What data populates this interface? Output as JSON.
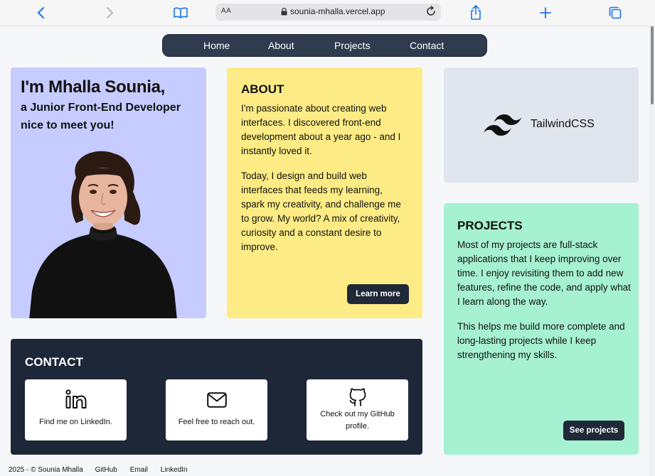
{
  "browser": {
    "reader_label": "AA",
    "url": "sounia-mhalla.vercel.app"
  },
  "nav": {
    "items": [
      "Home",
      "About",
      "Projects",
      "Contact"
    ]
  },
  "hero": {
    "title": "I'm Mhalla Sounia,",
    "subtitle": "a Junior Front-End Developer  nice to meet you!"
  },
  "about": {
    "heading": "ABOUT",
    "paragraph1": "I'm passionate about creating web interfaces. I discovered front-end development about a year ago - and I instantly loved it.",
    "paragraph2": "Today, I design and build web interfaces that feeds my learning, spark my creativity, and challenge me to grow. My world? A mix of creativity, curiosity and a constant desire to improve.",
    "button": "Learn more"
  },
  "tech": {
    "label": "TailwindCSS"
  },
  "projects": {
    "heading": "PROJECTS",
    "paragraph1": "Most of my projects are full-stack applications that I keep improving over time. I enjoy revisiting them to add new features, refine the code, and apply what I learn along the way.",
    "paragraph2": "This helps me build more complete and long-lasting projects while I keep strengthening my skills.",
    "button": "See projects"
  },
  "contact": {
    "heading": "CONTACT",
    "tiles": [
      {
        "icon": "linkedin-icon",
        "text": "Find me on LinkedIn."
      },
      {
        "icon": "mail-icon",
        "text": "Feel free to reach out."
      },
      {
        "icon": "github-icon",
        "text": "Check out my GitHub profile."
      }
    ]
  },
  "footer": {
    "copyright": "2025 - © Sounia Mhalla",
    "links": [
      "GitHub",
      "Email",
      "LinkedIn"
    ]
  },
  "colors": {
    "hero_bg": "#c6ccff",
    "about_bg": "#fdec85",
    "tech_bg": "#e1e5ed",
    "projects_bg": "#a6f1d1",
    "contact_bg": "#1e2738",
    "nav_bg": "#2f3c50",
    "accent_blue": "#1a73e8"
  }
}
